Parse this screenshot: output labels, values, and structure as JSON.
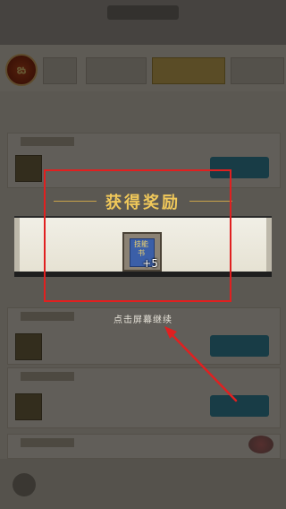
{
  "reward_title": "获得奖励",
  "reward": {
    "icon_text": "技能书",
    "count": "+5"
  },
  "continue_hint": "点击屏幕继续",
  "avatar_text": "ఙ",
  "colors": {
    "title": "#f0c85a",
    "highlight": "#e02020",
    "arrow": "#e02020",
    "overlay": "rgba(0,0,0,0.58)"
  }
}
